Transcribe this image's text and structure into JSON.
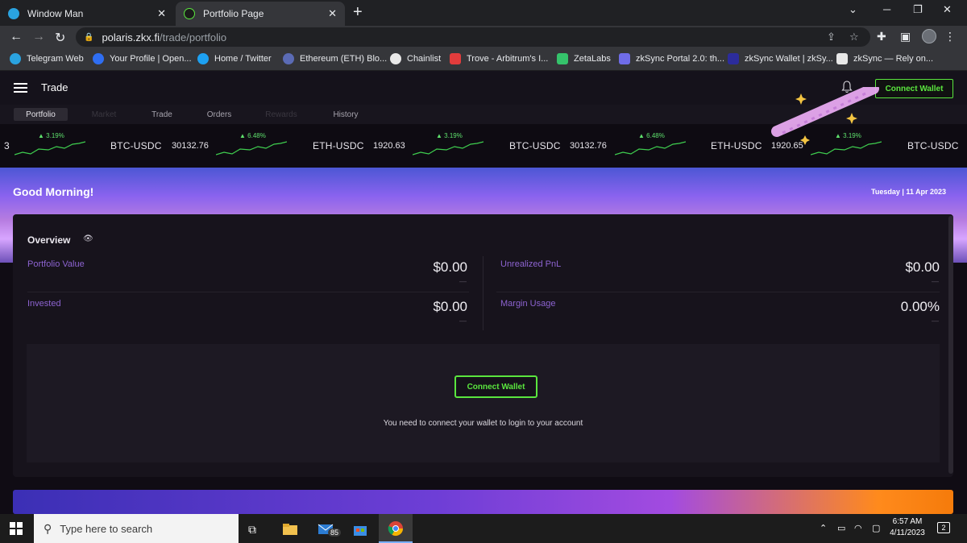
{
  "browser": {
    "tabs": [
      {
        "title": "Window Man",
        "close": "✕"
      },
      {
        "title": "Portfolio Page",
        "close": "✕"
      }
    ],
    "new_tab": "+",
    "url_host": "polaris.zkx.fi",
    "url_path": "/trade/portfolio",
    "bookmarks": [
      {
        "label": "Telegram Web",
        "color": "#2aa3e0"
      },
      {
        "label": "Your Profile | Open...",
        "color": "#2f6ef2"
      },
      {
        "label": "Home / Twitter",
        "color": "#1da1f2"
      },
      {
        "label": "Ethereum (ETH) Blo...",
        "color": "#5b6bb5"
      },
      {
        "label": "Chainlist",
        "color": "#e8e8e8"
      },
      {
        "label": "Trove - Arbitrum's I...",
        "color": "#e23c3c"
      },
      {
        "label": "ZetaLabs",
        "color": "#35c36b"
      },
      {
        "label": "zkSync Portal 2.0: th...",
        "color": "#6f6ce8"
      },
      {
        "label": "zkSync Wallet | zkSy...",
        "color": "#2c2c9c"
      },
      {
        "label": "zkSync — Rely on...",
        "color": "#e8e8e8"
      }
    ]
  },
  "app": {
    "title": "Trade",
    "connect_wallet": "Connect Wallet",
    "subnav": [
      "Portfolio",
      "Market",
      "Trade",
      "Orders",
      "Rewards",
      "History"
    ],
    "ticker": {
      "items": [
        {
          "change": "▲ 3.19%",
          "pair": "BTC-USDC",
          "price": "30132.76"
        },
        {
          "change": "▲ 6.48%",
          "pair": "ETH-USDC",
          "price": "1920.63"
        },
        {
          "change": "▲ 3.19%",
          "pair": "BTC-USDC",
          "price": "30132.76"
        },
        {
          "change": "▲ 6.48%",
          "pair": "ETH-USDC",
          "price": "1920.65"
        },
        {
          "change": "▲ 3.19%",
          "pair": "BTC-USDC",
          "price": ""
        }
      ],
      "leading_fragment": "3"
    },
    "greeting": "Good Morning!",
    "date": "Tuesday | 11 Apr 2023",
    "overview": {
      "title": "Overview",
      "metrics": [
        {
          "label": "Portfolio Value",
          "value": "$0.00",
          "sub": "—"
        },
        {
          "label": "Unrealized PnL",
          "value": "$0.00",
          "sub": "—"
        },
        {
          "label": "Invested",
          "value": "$0.00",
          "sub": "—"
        },
        {
          "label": "Margin Usage",
          "value": "0.00%",
          "sub": "—"
        }
      ]
    },
    "connect_prompt": {
      "button": "Connect Wallet",
      "message": "You need to connect your wallet to login to your account"
    }
  },
  "taskbar": {
    "search_placeholder": "Type here to search",
    "mail_badge": "85",
    "time": "6:57 AM",
    "date": "4/11/2023",
    "notifications": "2"
  }
}
